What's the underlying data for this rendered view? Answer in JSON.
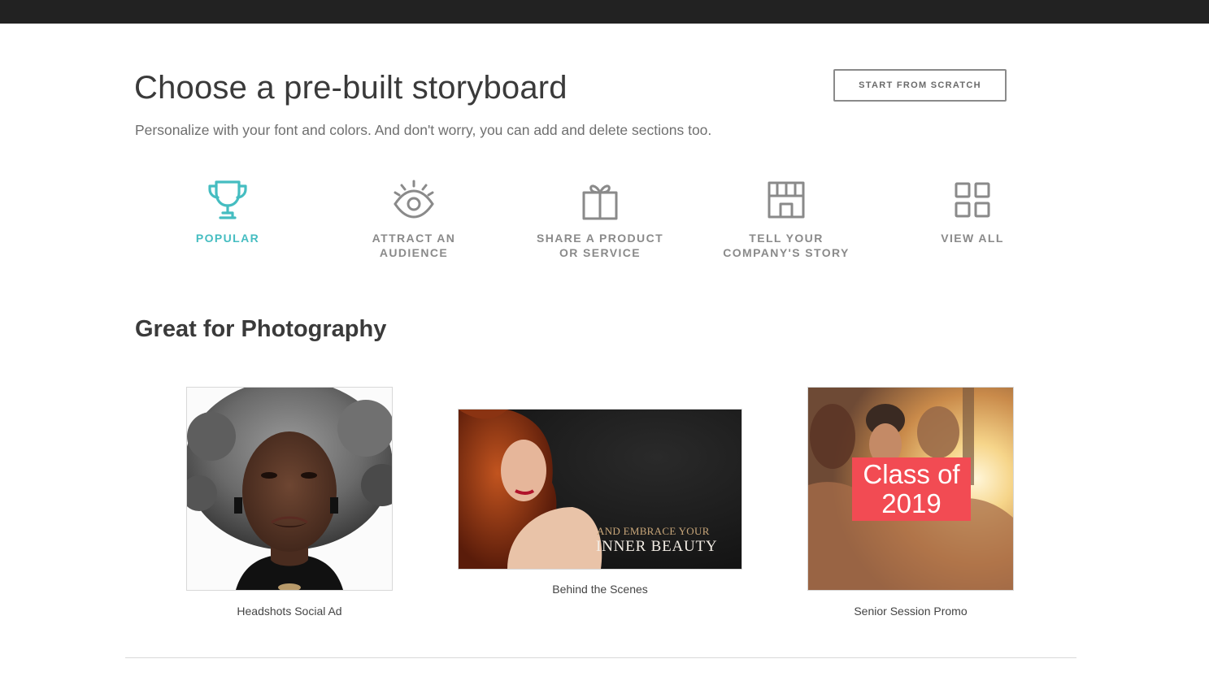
{
  "header": {
    "title": "Choose a pre-built storyboard",
    "subtitle": "Personalize with your font and colors. And don't worry, you can add and delete sections too.",
    "start_button": "START FROM SCRATCH"
  },
  "categories": [
    {
      "label": "POPULAR",
      "icon": "trophy-icon",
      "active": true
    },
    {
      "label": "ATTRACT AN AUDIENCE",
      "icon": "eye-icon",
      "active": false
    },
    {
      "label": "SHARE A PRODUCT OR SERVICE",
      "icon": "gift-icon",
      "active": false
    },
    {
      "label": "TELL YOUR COMPANY'S STORY",
      "icon": "storefront-icon",
      "active": false
    },
    {
      "label": "VIEW ALL",
      "icon": "grid-icon",
      "active": false
    }
  ],
  "section": {
    "title": "Great for Photography",
    "cards": [
      {
        "caption": "Headshots Social Ad"
      },
      {
        "caption": "Behind the Scenes",
        "overlay_line1": "AND EMBRACE YOUR",
        "overlay_line2": "INNER BEAUTY"
      },
      {
        "caption": "Senior Session Promo",
        "overlay": "Class of 2019"
      }
    ]
  },
  "colors": {
    "accent": "#45bdc1",
    "inactive": "#8a8a8a",
    "topbar": "#222222",
    "promo_red": "#f24b53"
  }
}
